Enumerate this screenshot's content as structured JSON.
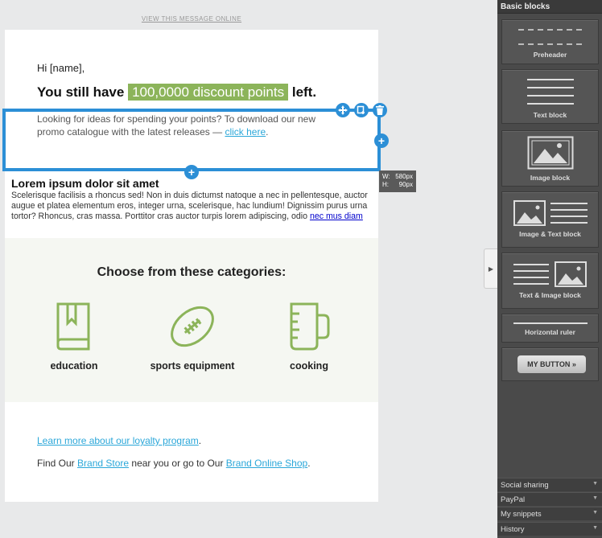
{
  "email": {
    "view_online": "VIEW THIS MESSAGE ONLINE",
    "greeting": "Hi [name],",
    "headline_prefix": "You still have",
    "headline_highlight": "100,0000 discount points",
    "headline_suffix": "left.",
    "promo_text": "Looking for ideas for spending your points? To download our new promo catalogue with the latest releases — ",
    "promo_link": "click here",
    "promo_end": ".",
    "lorem_title": "Lorem ipsum dolor sit amet",
    "lorem_body": "Scelerisque facilisis a rhoncus sed! Non in duis dictumst natoque a nec in pellentesque, auctor augue et platea elementum eros, integer urna, scelerisque, hac lundium! Dignissim purus urna tortor? Rhoncus, cras massa. Porttitor cras auctor turpis lorem adipiscing, odio ",
    "lorem_link": "nec mus diam",
    "categories_title": "Choose from these categories:",
    "categories": [
      {
        "label": "education",
        "icon": "book-icon"
      },
      {
        "label": "sports equipment",
        "icon": "football-icon"
      },
      {
        "label": "cooking",
        "icon": "measuring-cup-icon"
      }
    ],
    "loyalty_link": "Learn more about our loyalty program",
    "loyalty_end": ".",
    "store_prefix": "Find Our ",
    "store_link": "Brand Store",
    "store_middle": " near you or go to Our ",
    "store_online_link": "Brand Online Shop",
    "store_end": "."
  },
  "selection": {
    "width_label": "W:",
    "width_value": "580px",
    "height_label": "H:",
    "height_value": "90px"
  },
  "sidebar": {
    "title": "Basic blocks",
    "blocks": [
      "Preheader",
      "Text block",
      "Image block",
      "Image & Text block",
      "Text & Image block",
      "Horizontal ruler"
    ],
    "button_label": "MY BUTTON »",
    "sections": [
      "Social sharing",
      "PayPal",
      "My snippets",
      "History"
    ]
  },
  "colors": {
    "accent_green": "#8cb45a",
    "selection_blue": "#2c8fd6",
    "link_blue": "#2ba7d9"
  }
}
